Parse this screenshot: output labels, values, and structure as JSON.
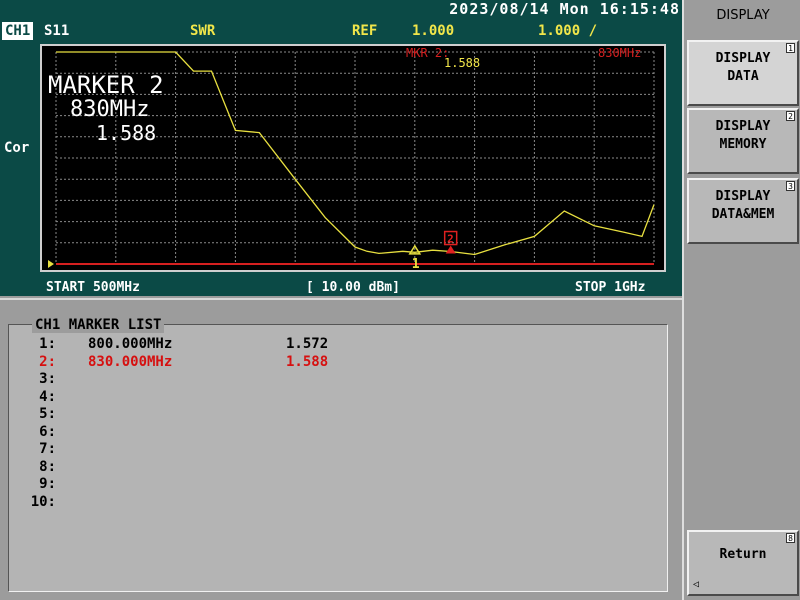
{
  "header": {
    "datetime": "2023/08/14 Mon 16:15:48",
    "channel": "CH1",
    "parameter": "S11",
    "format": "SWR",
    "ref_label": "REF",
    "ref_value": "1.000",
    "scale": "1.000 /",
    "side_label": "Cor"
  },
  "plot": {
    "marker_header": "MKR 2:",
    "marker_header_value": "1.588",
    "marker_header_freq": "830MHz",
    "big_marker": {
      "title": "MARKER 2",
      "freq": "830MHz",
      "value": "1.588"
    },
    "marker1_tag": "1",
    "marker2_tag": "2",
    "start": "START 500MHz",
    "power": "[ 10.00 dBm]",
    "stop": "STOP 1GHz",
    "trace_color": "#e8e040",
    "grid_color": "#8a8a8a",
    "ref_line_color": "#d62020"
  },
  "chart_data": {
    "type": "line",
    "x_unit": "MHz",
    "xlim": [
      500,
      1000
    ],
    "ylim": [
      1.0,
      11.0
    ],
    "reference": 1.0,
    "series": [
      {
        "x": [
          500,
          540,
          570,
          600,
          615,
          630,
          650,
          670,
          700,
          725,
          750,
          760,
          770,
          790,
          800,
          815,
          830,
          850,
          875,
          900,
          925,
          950,
          975,
          990,
          1000
        ],
        "y": [
          11.0,
          11.0,
          11.0,
          11.0,
          10.1,
          10.1,
          7.3,
          7.2,
          5.0,
          3.2,
          1.8,
          1.6,
          1.5,
          1.6,
          1.55,
          1.65,
          1.588,
          1.45,
          1.9,
          2.3,
          3.5,
          2.8,
          2.5,
          2.3,
          3.8
        ]
      }
    ],
    "markers": [
      {
        "id": 1,
        "freq": 800,
        "value": 1.572
      },
      {
        "id": 2,
        "freq": 830,
        "value": 1.588
      }
    ]
  },
  "marker_list": {
    "title": "CH1 MARKER LIST",
    "rows": [
      {
        "idx": "1:",
        "freq": "800.000MHz",
        "value": "1.572"
      },
      {
        "idx": "2:",
        "freq": "830.000MHz",
        "value": "1.588"
      },
      {
        "idx": "3:",
        "freq": "",
        "value": ""
      },
      {
        "idx": "4:",
        "freq": "",
        "value": ""
      },
      {
        "idx": "5:",
        "freq": "",
        "value": ""
      },
      {
        "idx": "6:",
        "freq": "",
        "value": ""
      },
      {
        "idx": "7:",
        "freq": "",
        "value": ""
      },
      {
        "idx": "8:",
        "freq": "",
        "value": ""
      },
      {
        "idx": "9:",
        "freq": "",
        "value": ""
      },
      {
        "idx": "10:",
        "freq": "",
        "value": ""
      }
    ]
  },
  "softkeys": {
    "title": "DISPLAY",
    "k1": {
      "label": "DISPLAY\nDATA",
      "num": "1"
    },
    "k2": {
      "label": "DISPLAY\nMEMORY",
      "num": "2"
    },
    "k3": {
      "label": "DISPLAY\nDATA&MEM",
      "num": "3"
    },
    "k8": {
      "label": "Return",
      "num": "8",
      "arrow": "◁"
    }
  }
}
